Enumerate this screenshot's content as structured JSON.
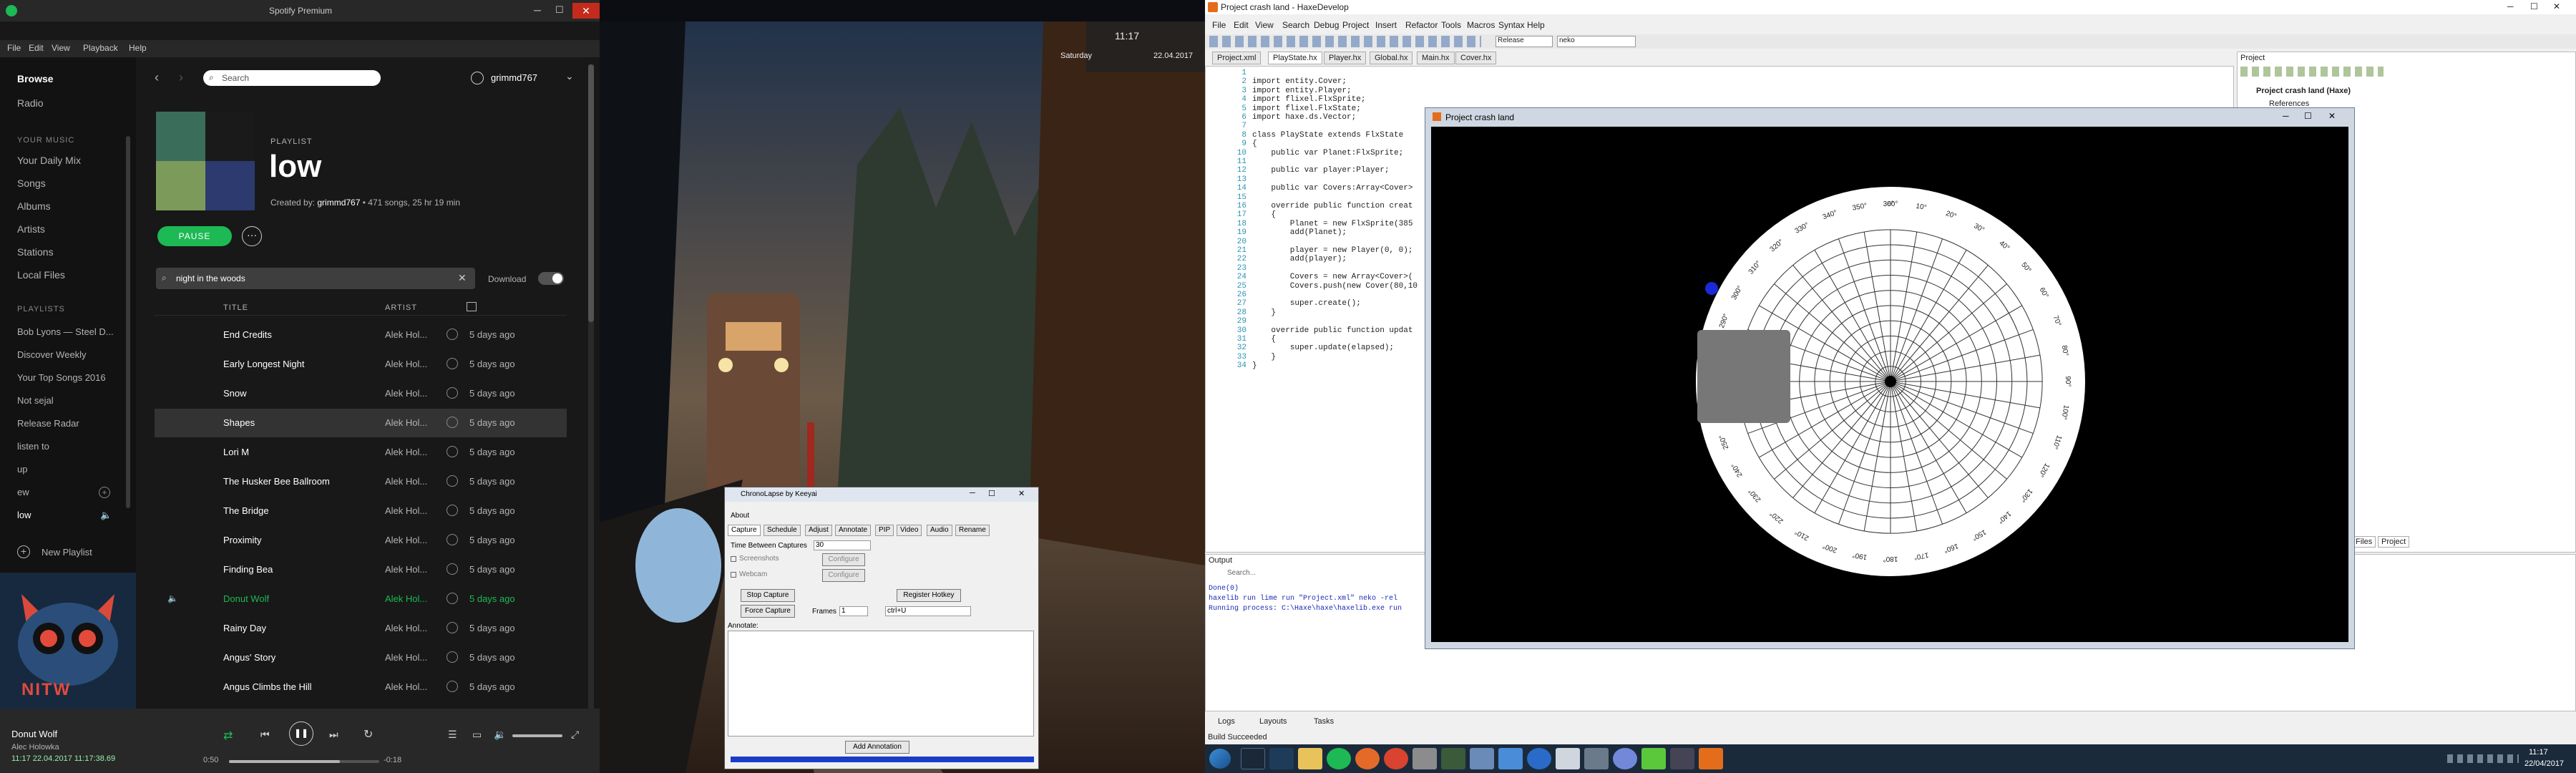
{
  "spotify": {
    "window_title": "Spotify Premium",
    "menu": [
      "File",
      "Edit",
      "View",
      "Playback",
      "Help"
    ],
    "nav": {
      "browse": "Browse",
      "radio": "Radio"
    },
    "library": {
      "heading": "YOUR MUSIC",
      "items": [
        "Your Daily Mix",
        "Songs",
        "Albums",
        "Artists",
        "Stations",
        "Local Files"
      ]
    },
    "playlists": {
      "heading": "PLAYLISTS",
      "items": [
        "Bob Lyons — Steel D...",
        "Discover Weekly",
        "Your Top Songs 2016",
        "Not sejal",
        "Release Radar",
        "listen to",
        "up",
        "ew",
        "low"
      ]
    },
    "new_playlist": "New Playlist",
    "album_badge": "NITW",
    "now_playing": {
      "title": "Donut Wolf",
      "artist": "Alec Holowka",
      "time_elapsed": "0:50",
      "time_total": "-0:18",
      "progress": 0.74,
      "timestamp": "11:17 22.04.2017 11:17:38.69"
    },
    "search_placeholder": "Search",
    "user": "grimmd767",
    "playlist": {
      "label": "PLAYLIST",
      "name": "low",
      "created_by_prefix": "Created by: ",
      "owner": "grimmd767",
      "meta": " • 471 songs, 25 hr 19 min",
      "pause": "PAUSE"
    },
    "filter": "night in the woods",
    "download": "Download",
    "columns": {
      "title": "TITLE",
      "artist": "ARTIST"
    },
    "tracks": [
      {
        "title": "End Credits",
        "artist": "Alek Hol...",
        "date": "5 days ago"
      },
      {
        "title": "Early Longest Night",
        "artist": "Alek Hol...",
        "date": "5 days ago"
      },
      {
        "title": "Snow",
        "artist": "Alek Hol...",
        "date": "5 days ago"
      },
      {
        "title": "Shapes",
        "artist": "Alek Hol...",
        "date": "5 days ago"
      },
      {
        "title": "Lori M",
        "artist": "Alek Hol...",
        "date": "5 days ago"
      },
      {
        "title": "The Husker Bee Ballroom",
        "artist": "Alek Hol...",
        "date": "5 days ago"
      },
      {
        "title": "The Bridge",
        "artist": "Alek Hol...",
        "date": "5 days ago"
      },
      {
        "title": "Proximity",
        "artist": "Alek Hol...",
        "date": "5 days ago"
      },
      {
        "title": "Finding Bea",
        "artist": "Alek Hol...",
        "date": "5 days ago"
      },
      {
        "title": "Donut Wolf",
        "artist": "Alek Hol...",
        "date": "5 days ago"
      },
      {
        "title": "Rainy Day",
        "artist": "Alek Hol...",
        "date": "5 days ago"
      },
      {
        "title": "Angus' Story",
        "artist": "Alek Hol...",
        "date": "5 days ago"
      },
      {
        "title": "Angus Climbs the Hill",
        "artist": "Alek Hol...",
        "date": "5 days ago"
      }
    ],
    "playing_index": 9,
    "accent": "#1db954"
  },
  "clock_widget": {
    "time": "11:17",
    "day": "Saturday",
    "date": "22.04.2017"
  },
  "chronolapse": {
    "title": "ChronoLapse by Keeyai",
    "about": "About",
    "tabs": [
      "Capture",
      "Schedule",
      "Adjust",
      "Annotate",
      "PIP",
      "Video",
      "Audio",
      "Rename"
    ],
    "time_between": "Time Between Captures",
    "time_value": "30",
    "screenshots": "Screenshots",
    "webcam": "Webcam",
    "configure": "Configure",
    "stop_capture": "Stop Capture",
    "register_hotkey": "Register Hotkey",
    "force_capture": "Force Capture",
    "frames_label": "Frames",
    "frames_value": "1",
    "hotkey_value": "ctrl+U",
    "annotate_label": "Annotate:",
    "add_annotation": "Add Annotation"
  },
  "haxe": {
    "window_title": "Project crash land - HaxeDevelop",
    "menu": [
      "File",
      "Edit",
      "View",
      "Search",
      "Debug",
      "Project",
      "Insert",
      "Refactor",
      "Tools",
      "Macros",
      "Syntax",
      "Help"
    ],
    "config": "Release",
    "platform": "neko",
    "tabs": [
      "Project.xml",
      "PlayState.hx",
      "Player.hx",
      "Global.hx",
      "Main.hx",
      "Cover.hx"
    ],
    "active_tab": 1,
    "code": [
      "",
      "import entity.Cover;",
      "import entity.Player;",
      "import flixel.FlxSprite;",
      "import flixel.FlxState;",
      "import haxe.ds.Vector;",
      "",
      "class PlayState extends FlxState",
      "{",
      "    public var Planet:FlxSprite;",
      "",
      "    public var player:Player;",
      "",
      "    public var Covers:Array<Cover>",
      "",
      "    override public function creat",
      "    {",
      "        Planet = new FlxSprite(385",
      "        add(Planet);",
      "",
      "        player = new Player(0, 0);",
      "        add(player);",
      "",
      "        Covers = new Array<Cover>(",
      "        Covers.push(new Cover(80,10",
      "",
      "        super.create();",
      "    }",
      "",
      "    override public function updat",
      "    {",
      "        super.update(elapsed);",
      "    }",
      "}"
    ],
    "project_panel": "Project",
    "project_root": "Project crash land (Haxe)",
    "references": "References",
    "files_tab": "Files",
    "project_tab": "Project",
    "output_title": "Output",
    "output_search": "Search...",
    "output_lines": [
      "Done(0)",
      "haxelib run lime run \"Project.xml\" neko -rel",
      "Running process: C:\\Haxe\\haxe\\haxelib.exe run"
    ],
    "bottom_tabs": [
      "Logs",
      "Layouts",
      "Tasks"
    ],
    "status": "Build Succeeded"
  },
  "crash_land": {
    "title": "Project crash land",
    "angle_labels": [
      "0°",
      "10°",
      "20°",
      "30°",
      "40°",
      "50°",
      "60°",
      "70°",
      "80°",
      "90°",
      "100°",
      "110°",
      "120°",
      "130°",
      "140°",
      "150°",
      "160°",
      "170°",
      "180°",
      "190°",
      "200°",
      "210°",
      "220°",
      "230°",
      "240°",
      "250°",
      "260°",
      "270°",
      "280°",
      "290°",
      "300°",
      "310°",
      "320°",
      "330°",
      "340°",
      "350°",
      "360°"
    ]
  },
  "taskbar": {
    "time": "11:17",
    "date": "22/04/2017"
  }
}
